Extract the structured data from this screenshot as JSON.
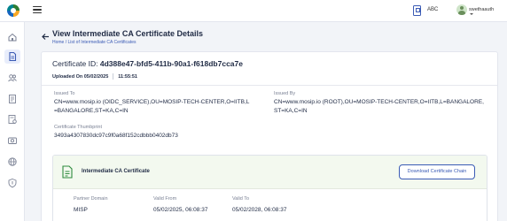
{
  "header": {
    "language": "ABC",
    "user_name": "swethaauth"
  },
  "page": {
    "title": "View Intermediate CA Certificate Details",
    "breadcrumb": "Home / List of Intermediate CA Certificates"
  },
  "certificate": {
    "id_label": "Certificate ID: ",
    "id_value": "4d388e47-bfd5-411b-90a1-f618db7cca7e",
    "uploaded_on": "Uploaded On 05/02/2025",
    "uploaded_time": "11:55:51",
    "issued_to_label": "Issued To",
    "issued_to_value": "CN=www.mosip.io (OIDC_SERVICE),OU=MOSIP-TECH-CENTER,O=IITB,L=BANGALORE,ST=KA,C=IN",
    "issued_by_label": "Issued By",
    "issued_by_value": "CN=www.mosip.io (ROOT),OU=MOSIP-TECH-CENTER,O=IITB,L=BANGALORE,ST=KA,C=IN",
    "thumbprint_label": "Certificate Thumbprint",
    "thumbprint_value": "3493a4307830dc97c9f0a68f152cdbbb0402db73"
  },
  "subcard": {
    "title": "Intermediate CA Certificate",
    "download_label": "Download Certificate Chain",
    "partner_domain_label": "Partner Domain",
    "partner_domain_value": "MISP",
    "valid_from_label": "Valid From",
    "valid_from_value": "05/02/2025, 06:08:37",
    "valid_to_label": "Valid To",
    "valid_to_value": "05/02/2028, 06:08:37"
  },
  "icons": {
    "sidebar": [
      "home-icon",
      "document-icon",
      "partners-icon",
      "policy-icon",
      "certificate-list-icon",
      "device-icon",
      "globe-icon",
      "shield-icon"
    ],
    "accent_color": "#3b5bb5",
    "success_color": "#2e8b3d"
  }
}
